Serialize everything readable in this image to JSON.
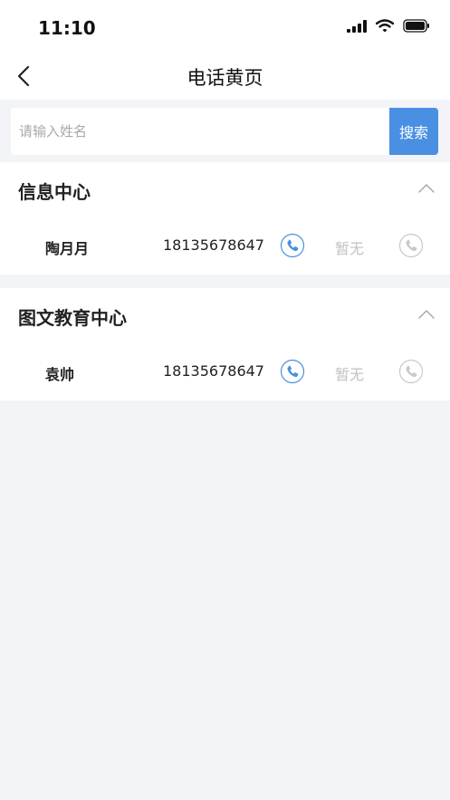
{
  "status_bar": {
    "time": "11:10",
    "icons": [
      "signal-icon",
      "wifi-icon",
      "battery-icon"
    ]
  },
  "nav": {
    "title": "电话黄页",
    "back_icon": "chevron-left-icon"
  },
  "search": {
    "placeholder": "请输入姓名",
    "value": "",
    "button_label": "搜索"
  },
  "groups": [
    {
      "title": "信息中心",
      "expanded": true,
      "contacts": [
        {
          "name": "陶月月",
          "phone": "18135678647",
          "secondary": "暂无"
        }
      ]
    },
    {
      "title": "图文教育中心",
      "expanded": true,
      "contacts": [
        {
          "name": "袁帅",
          "phone": "18135678647",
          "secondary": "暂无"
        }
      ]
    }
  ],
  "colors": {
    "accent": "#4a90e2",
    "background": "#f3f4f8",
    "muted": "#c2c2c2"
  }
}
